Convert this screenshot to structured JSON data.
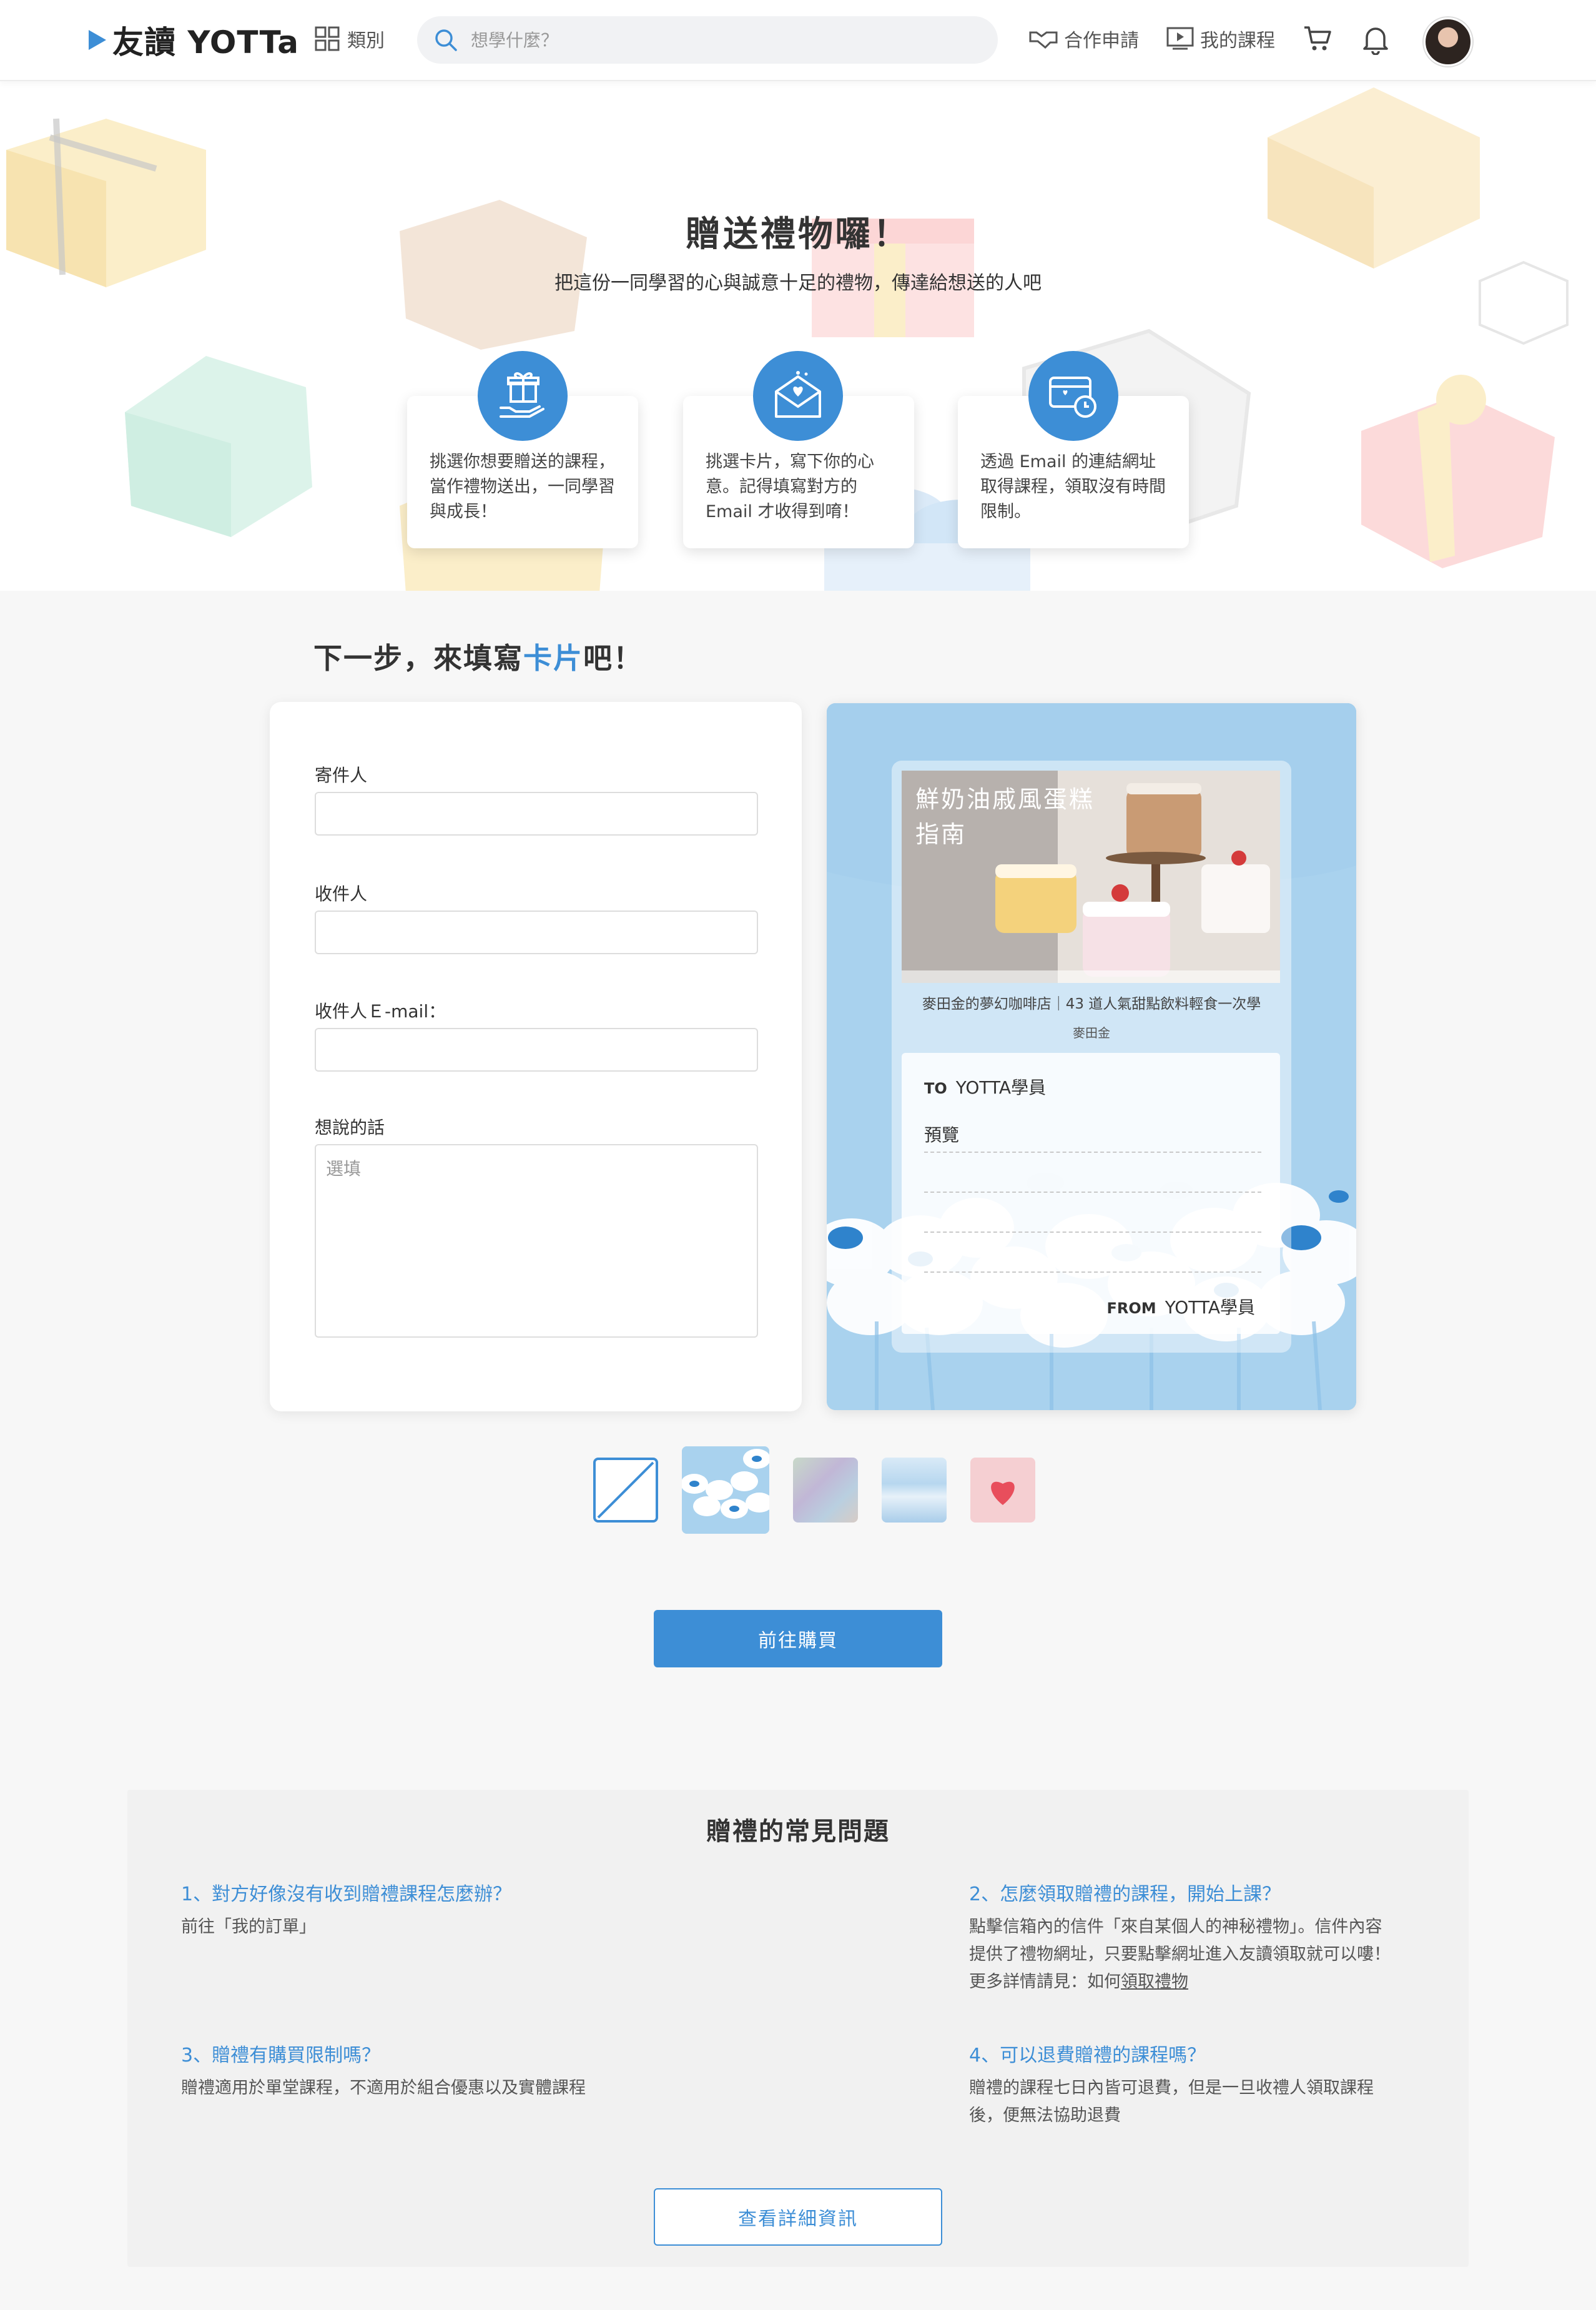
{
  "nav": {
    "logo_text": "友讀 YOTTa",
    "category_label": "類別",
    "search_placeholder": "想學什麼？",
    "partner_label": "合作申請",
    "my_courses_label": "我的課程"
  },
  "hero": {
    "title": "贈送禮物囉！",
    "subtitle": "把這份一同學習的心與誠意十足的禮物，傳達給想送的人吧",
    "steps": [
      {
        "text": "挑選你想要贈送的課程，當作禮物送出，一同學習與成長！",
        "icon": "gift-hand-icon"
      },
      {
        "text": "挑選卡片，寫下你的心意。記得填寫對方的 Email 才收得到唷！",
        "icon": "envelope-heart-icon"
      },
      {
        "text": "透過 Email 的連結網址取得課程，領取沒有時間限制。",
        "icon": "card-clock-icon"
      }
    ]
  },
  "card_section": {
    "title_prefix": "下一步，來填寫",
    "title_highlight": "卡片",
    "title_suffix": "吧！"
  },
  "form": {
    "sender_label": "寄件人",
    "recipient_label": "收件人",
    "recipient_email_label": "收件人Ｅ-mail：",
    "message_label": "想說的話",
    "message_placeholder": "選填"
  },
  "preview": {
    "cover_title_line1": "鮮奶油戚風蛋糕",
    "cover_title_line2": "指南",
    "course_title": "麥田金的夢幻咖啡店｜43 道人氣甜點飲料輕食一次學",
    "author": "麥田金",
    "to_label": "TO",
    "to_name": "YOTTA學員",
    "message_preview": "預覽",
    "from_label": "FROM",
    "from_name": "YOTTA學員"
  },
  "themes": [
    {
      "name": "none",
      "selected": false
    },
    {
      "name": "blue-flowers",
      "selected": true
    },
    {
      "name": "holographic",
      "selected": false
    },
    {
      "name": "waves",
      "selected": false
    },
    {
      "name": "pink-heart",
      "selected": false
    }
  ],
  "buy_button_label": "前往購買",
  "faq": {
    "title": "贈禮的常見問題",
    "q1": "1、對方好像沒有收到贈禮課程怎麼辦？",
    "a1": "前往「我的訂單」",
    "q2": "2、怎麼領取贈禮的課程，開始上課？",
    "a2_line1": "點擊信箱內的信件「來自某個人的神秘禮物」。信件內容",
    "a2_line2": "提供了禮物網址，只要點擊網址進入友讀領取就可以嘍！",
    "a2_line3_prefix": "更多詳情請見：如何",
    "a2_link": "領取禮物",
    "q3": "3、贈禮有購買限制嗎？",
    "a3": "贈禮適用於單堂課程，不適用於組合優惠以及實體課程",
    "q4": "4、可以退費贈禮的課程嗎？",
    "a4_line1": "贈禮的課程七日內皆可退費，但是一旦收禮人領取課程",
    "a4_line2": "後，便無法協助退費",
    "detail_button_label": "查看詳細資訊"
  },
  "colors": {
    "accent": "#3d8ed6",
    "card_bg": "#a9d2ee"
  }
}
